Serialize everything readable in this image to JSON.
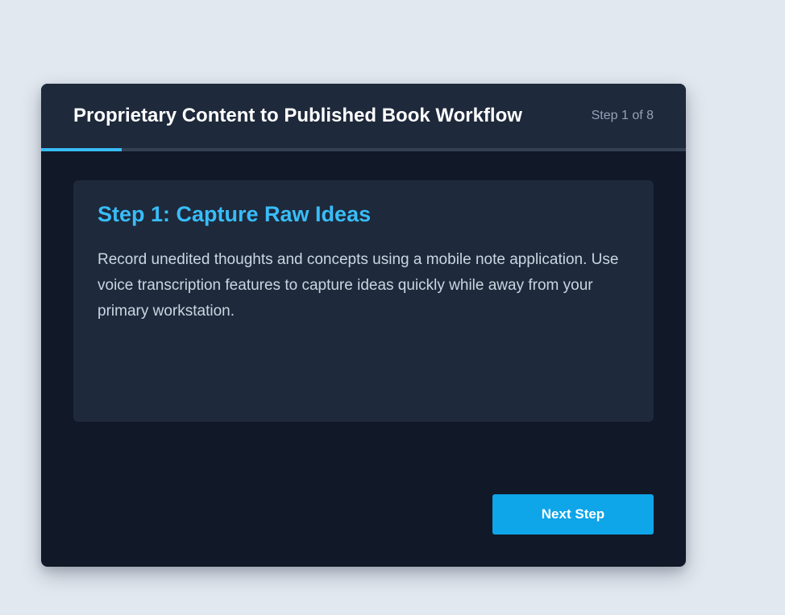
{
  "header": {
    "title": "Proprietary Content to Published Book Workflow",
    "step_counter": "Step 1 of 8"
  },
  "progress": {
    "current_step": 1,
    "total_steps": 8,
    "fraction": 0.125,
    "color": "#38bdf8"
  },
  "step": {
    "heading": "Step 1: Capture Raw Ideas",
    "body": "Record unedited thoughts and concepts using a mobile note application. Use voice transcription features to capture ideas quickly while away from your primary workstation."
  },
  "actions": {
    "next_label": "Next Step"
  },
  "colors": {
    "page_background": "#e2e8f0",
    "card_background": "#111827",
    "header_background": "#1e293b",
    "accent": "#38bdf8",
    "button": "#0ea5e9"
  }
}
